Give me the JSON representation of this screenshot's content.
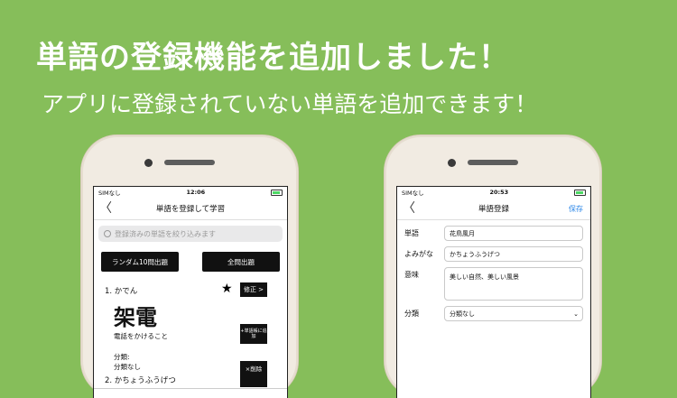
{
  "headline": "単語の登録機能を追加しました！",
  "subheadline": "アプリに登録されていない単語を追加できます！",
  "left": {
    "status": {
      "carrier": "SIMなし",
      "time": "12:06"
    },
    "nav": {
      "back": "〈",
      "title": "単語を登録して学習"
    },
    "search_placeholder": "登録済みの単語を絞り込みます",
    "random_button": "ランダム10問出題",
    "all_button": "全問出題",
    "card": {
      "number": "1. かでん",
      "star": "★",
      "edit": "修正 >",
      "kanji": "架電",
      "meaning": "電話をかけること",
      "add_to_book": "+単語帳に追加",
      "category_label": "分類:",
      "category_value": "分類なし",
      "delete": "×削除"
    },
    "next_item": "2. かちょうふうげつ"
  },
  "right": {
    "status": {
      "carrier": "SIMなし",
      "time": "20:53"
    },
    "nav": {
      "back": "〈",
      "title": "単語登録",
      "save": "保存"
    },
    "fields": [
      {
        "label": "単語",
        "value": "花鳥風月"
      },
      {
        "label": "よみがな",
        "value": "かちょうふうげつ"
      },
      {
        "label": "意味",
        "value": "美しい自然、美しい風景"
      },
      {
        "label": "分類",
        "value": "分類なし"
      }
    ]
  }
}
